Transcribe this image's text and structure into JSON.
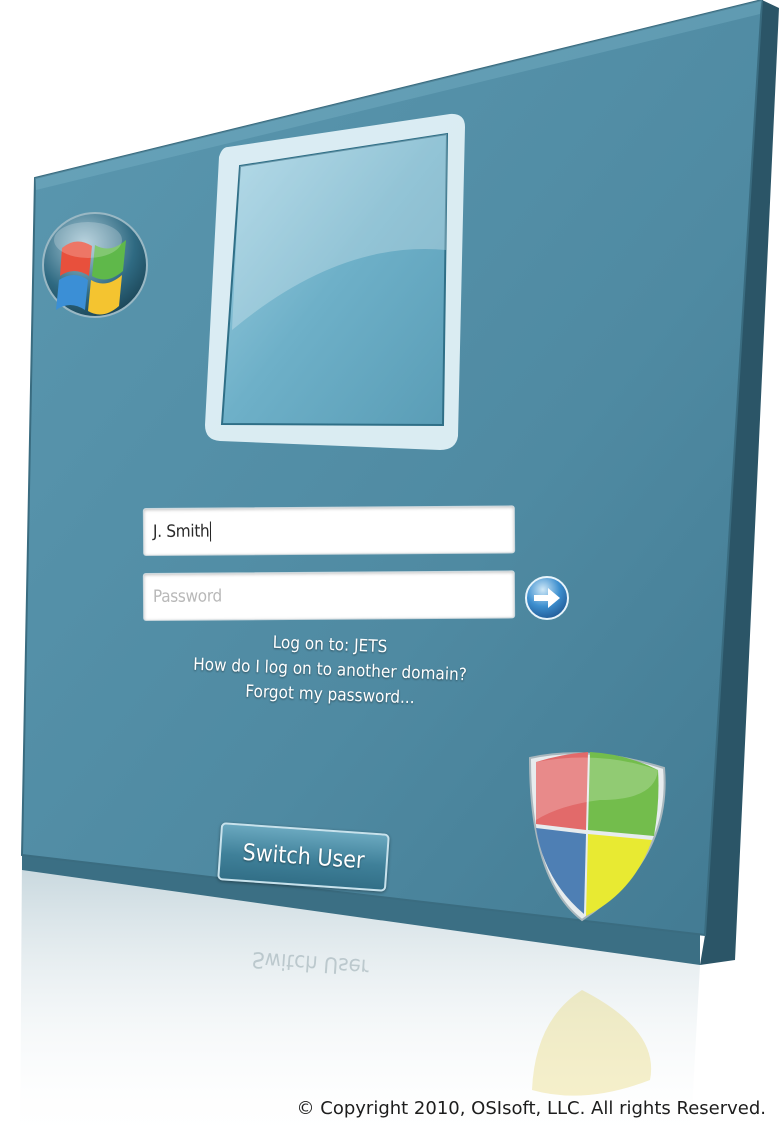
{
  "login": {
    "username_value": "J. Smith",
    "password_placeholder": "Password",
    "logon_to_text": "Log on to: JETS",
    "domain_help_link": "How do I log on to another domain?",
    "forgot_password_link": "Forgot my password...",
    "switch_user_label": "Switch User"
  },
  "icons": {
    "go": "arrow-right-icon",
    "windows_orb": "windows-logo-icon",
    "shield": "security-shield-icon",
    "user_tile": "user-picture-frame"
  },
  "footer": {
    "copyright": "© Copyright 2010, OSIsoft, LLC.  All rights Reserved."
  },
  "colors": {
    "panel": "#5c9ab3",
    "panel_edge": "#2c5668",
    "text": "#ffffff"
  }
}
